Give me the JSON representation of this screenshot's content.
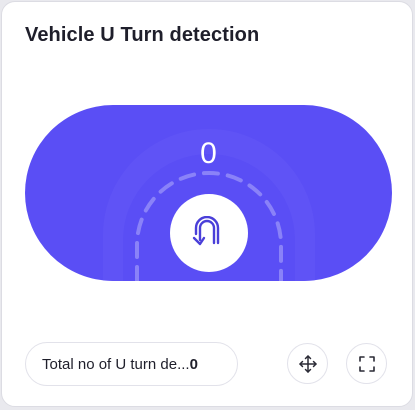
{
  "widget": {
    "title": "Vehicle U Turn detection",
    "count": "0",
    "footer": {
      "label": "Total no of U turn de...",
      "value": "0"
    }
  },
  "colors": {
    "accent": "#5a4ef5",
    "icon": "#4a3fd9",
    "text": "#1f1f2b"
  },
  "icons": {
    "center": "u-turn-icon",
    "move": "move-icon",
    "expand": "fullscreen-icon"
  }
}
